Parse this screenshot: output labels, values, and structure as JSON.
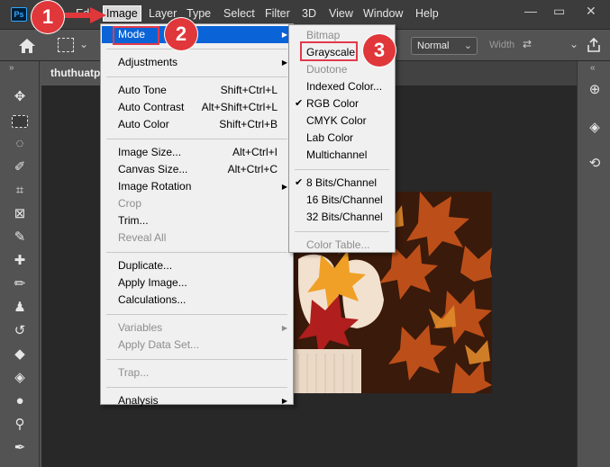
{
  "app": {
    "logo_text": "Ps"
  },
  "menubar": {
    "items": [
      "Edit",
      "Image",
      "Layer",
      "Type",
      "Select",
      "Filter",
      "3D",
      "View",
      "Window",
      "Help"
    ]
  },
  "window_controls": {
    "minimize": "—",
    "restore": "▭",
    "close": "✕"
  },
  "options_bar": {
    "mode_value": "Normal",
    "width_label": "Width"
  },
  "document_tab": {
    "title": "thuthuatpl"
  },
  "image_menu": {
    "groups": [
      [
        {
          "label": "Mode",
          "highlighted": true,
          "submenu": true
        }
      ],
      [
        {
          "label": "Adjustments",
          "submenu": true
        }
      ],
      [
        {
          "label": "Auto Tone",
          "shortcut": "Shift+Ctrl+L"
        },
        {
          "label": "Auto Contrast",
          "shortcut": "Alt+Shift+Ctrl+L"
        },
        {
          "label": "Auto Color",
          "shortcut": "Shift+Ctrl+B"
        }
      ],
      [
        {
          "label": "Image Size...",
          "shortcut": "Alt+Ctrl+I"
        },
        {
          "label": "Canvas Size...",
          "shortcut": "Alt+Ctrl+C"
        },
        {
          "label": "Image Rotation",
          "submenu": true
        },
        {
          "label": "Crop",
          "disabled": true
        },
        {
          "label": "Trim..."
        },
        {
          "label": "Reveal All",
          "disabled": true
        }
      ],
      [
        {
          "label": "Duplicate..."
        },
        {
          "label": "Apply Image..."
        },
        {
          "label": "Calculations..."
        }
      ],
      [
        {
          "label": "Variables",
          "disabled": true,
          "submenu": true
        },
        {
          "label": "Apply Data Set...",
          "disabled": true
        }
      ],
      [
        {
          "label": "Trap...",
          "disabled": true
        }
      ],
      [
        {
          "label": "Analysis",
          "submenu": true
        }
      ]
    ]
  },
  "mode_menu": {
    "groups": [
      [
        {
          "label": "Bitmap",
          "disabled": true
        },
        {
          "label": "Grayscale",
          "boxed": true
        },
        {
          "label": "Duotone",
          "disabled": true
        },
        {
          "label": "Indexed Color..."
        },
        {
          "label": "RGB Color",
          "checked": true
        },
        {
          "label": "CMYK Color"
        },
        {
          "label": "Lab Color"
        },
        {
          "label": "Multichannel"
        }
      ],
      [
        {
          "label": "8 Bits/Channel",
          "checked": true
        },
        {
          "label": "16 Bits/Channel"
        },
        {
          "label": "32 Bits/Channel"
        }
      ],
      [
        {
          "label": "Color Table...",
          "disabled": true
        }
      ]
    ]
  },
  "annotations": {
    "step1": "1",
    "step2": "2",
    "step3": "3"
  },
  "colors": {
    "highlight": "#0a64d7",
    "annotation_red": "#e0373b",
    "menubar_bg": "#3c3c3c"
  }
}
